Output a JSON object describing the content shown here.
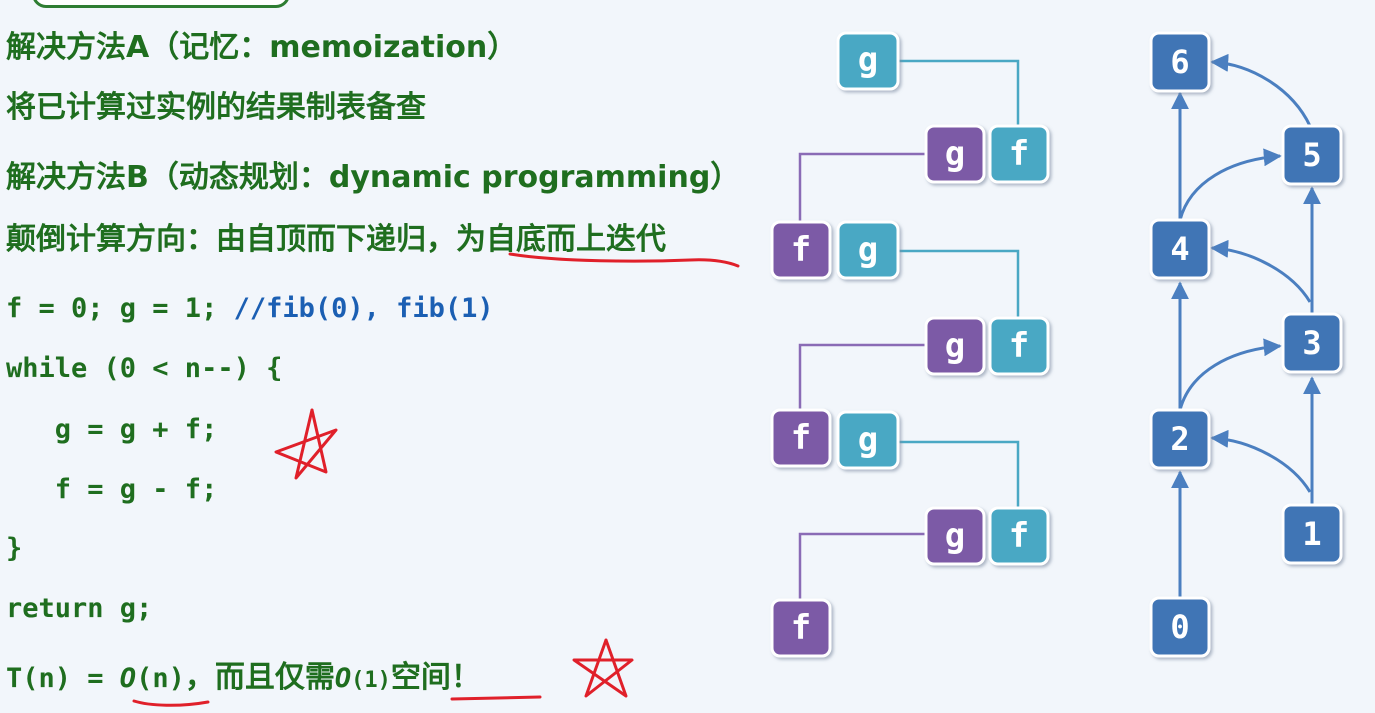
{
  "text": {
    "memo_title": "解决方法A（记忆：memoization）",
    "memo_desc": "将已计算过实例的结果制表备查",
    "dp_title": "解决方法B（动态规划：dynamic programming）",
    "dp_desc_prefix": "颠倒计算方向：由自顶而下递归，",
    "dp_desc_underlined": "为自底而上迭代"
  },
  "code": {
    "line1_code": "f = 0; g = 1; ",
    "line1_comment": "//fib(0), fib(1)",
    "line2": "while (0 < n--) {",
    "line3": "   g = g + f;",
    "line4": "   f = g - f;",
    "line5": "}",
    "line6": "return g;"
  },
  "complexity": {
    "prefix": "T(n) = ",
    "big_o_time": "O",
    "time_arg": "(n)",
    "middle": "，而且仅需",
    "big_o_space": "O",
    "space_arg": "(1)",
    "underlined": "空间！"
  },
  "left_diagram": {
    "nodes": [
      "g",
      "g",
      "f",
      "f",
      "g",
      "g",
      "f",
      "f",
      "g",
      "g",
      "f",
      "f"
    ],
    "colors": {
      "purple": "#7b5aa6",
      "teal": "#4aa8c4",
      "line_purple": "#8a6bb5",
      "line_teal": "#4aa8c4"
    }
  },
  "right_diagram": {
    "nodes": [
      "6",
      "5",
      "4",
      "3",
      "2",
      "1",
      "0"
    ],
    "colors": {
      "node": "#3f74b5",
      "edge": "#4b7fc0"
    }
  },
  "colors": {
    "text_green": "#1f6e1f",
    "comment_blue": "#1b5fb3",
    "annotation_red": "#e0202a",
    "background": "#f2f6fb"
  }
}
